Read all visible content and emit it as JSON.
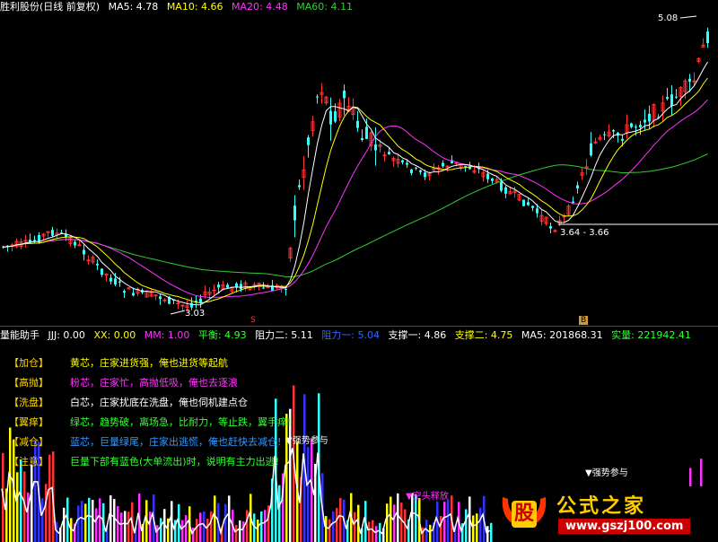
{
  "colors": {
    "up": "#ff3333",
    "down": "#33ffff",
    "ma5": "#ffffff",
    "ma10": "#ffff00",
    "ma20": "#ff33ff",
    "ma60": "#33cc33",
    "text_yellow": "#ffd700",
    "text_cyan": "#00ffff",
    "text_green": "#00ff00",
    "text_magenta": "#ff00ff",
    "text_white": "#ffffff",
    "logo_red": "#ff3300",
    "logo_yellow": "#ffcc00"
  },
  "header": {
    "title": "胜利股份(日线 前复权)",
    "ma5": "MA5: 4.78",
    "ma10": "MA10: 4.66",
    "ma20": "MA20: 4.48",
    "ma60": "MA60: 4.11"
  },
  "price_annotations": {
    "high": "5.08",
    "low": "3.03",
    "range": "3.64 - 3.66",
    "marker_s": "S",
    "marker_b": "B"
  },
  "indicator_header": {
    "name": "量能助手",
    "jjj": "JJJ: 0.00",
    "xx": "XX: 0.00",
    "mm": "MM: 1.00",
    "pingheng": "平衡: 4.93",
    "zuli2": "阻力二: 5.11",
    "zuli1": "阻力一: 5.04",
    "zhicheng1": "支撑一: 4.86",
    "zhicheng2": "支撑二: 4.75",
    "ma5": "MA5: 201868.31",
    "shiliang": "实量: 221942.41"
  },
  "legend": [
    {
      "tag": "【加仓】",
      "text": "黄芯，庄家进货强，俺也进货等起航",
      "color": "#ffff00"
    },
    {
      "tag": "【高抛】",
      "text": "粉芯，庄家忙，高抛低吸，俺也去逐浪",
      "color": "#ff33ff"
    },
    {
      "tag": "【洗盘】",
      "text": "白芯，庄家扰底在洗盘，俺也伺机建点仓",
      "color": "#ffffff"
    },
    {
      "tag": "【翼痒】",
      "text": "绿芯，趋势破，离场急，比耐力，等止跌，翼手痒!",
      "color": "#33ff33"
    },
    {
      "tag": "【减仓】",
      "text": "蓝芯，巨量绿尾，庄家出逃慌，俺也赶快去减仓!",
      "color": "#3399ff"
    },
    {
      "tag": "【注意】",
      "text": "巨量下部有蓝色(大单流出)时，说明有主力出逃!",
      "color": "#33ff33"
    }
  ],
  "volume_annotations": {
    "strong1": "▼强势参与",
    "strong2": "▼强势参与",
    "short_release": "▼空头释放"
  },
  "logo": {
    "char": "股",
    "name": "公式之家",
    "url": "www.gszj100.com"
  }
}
